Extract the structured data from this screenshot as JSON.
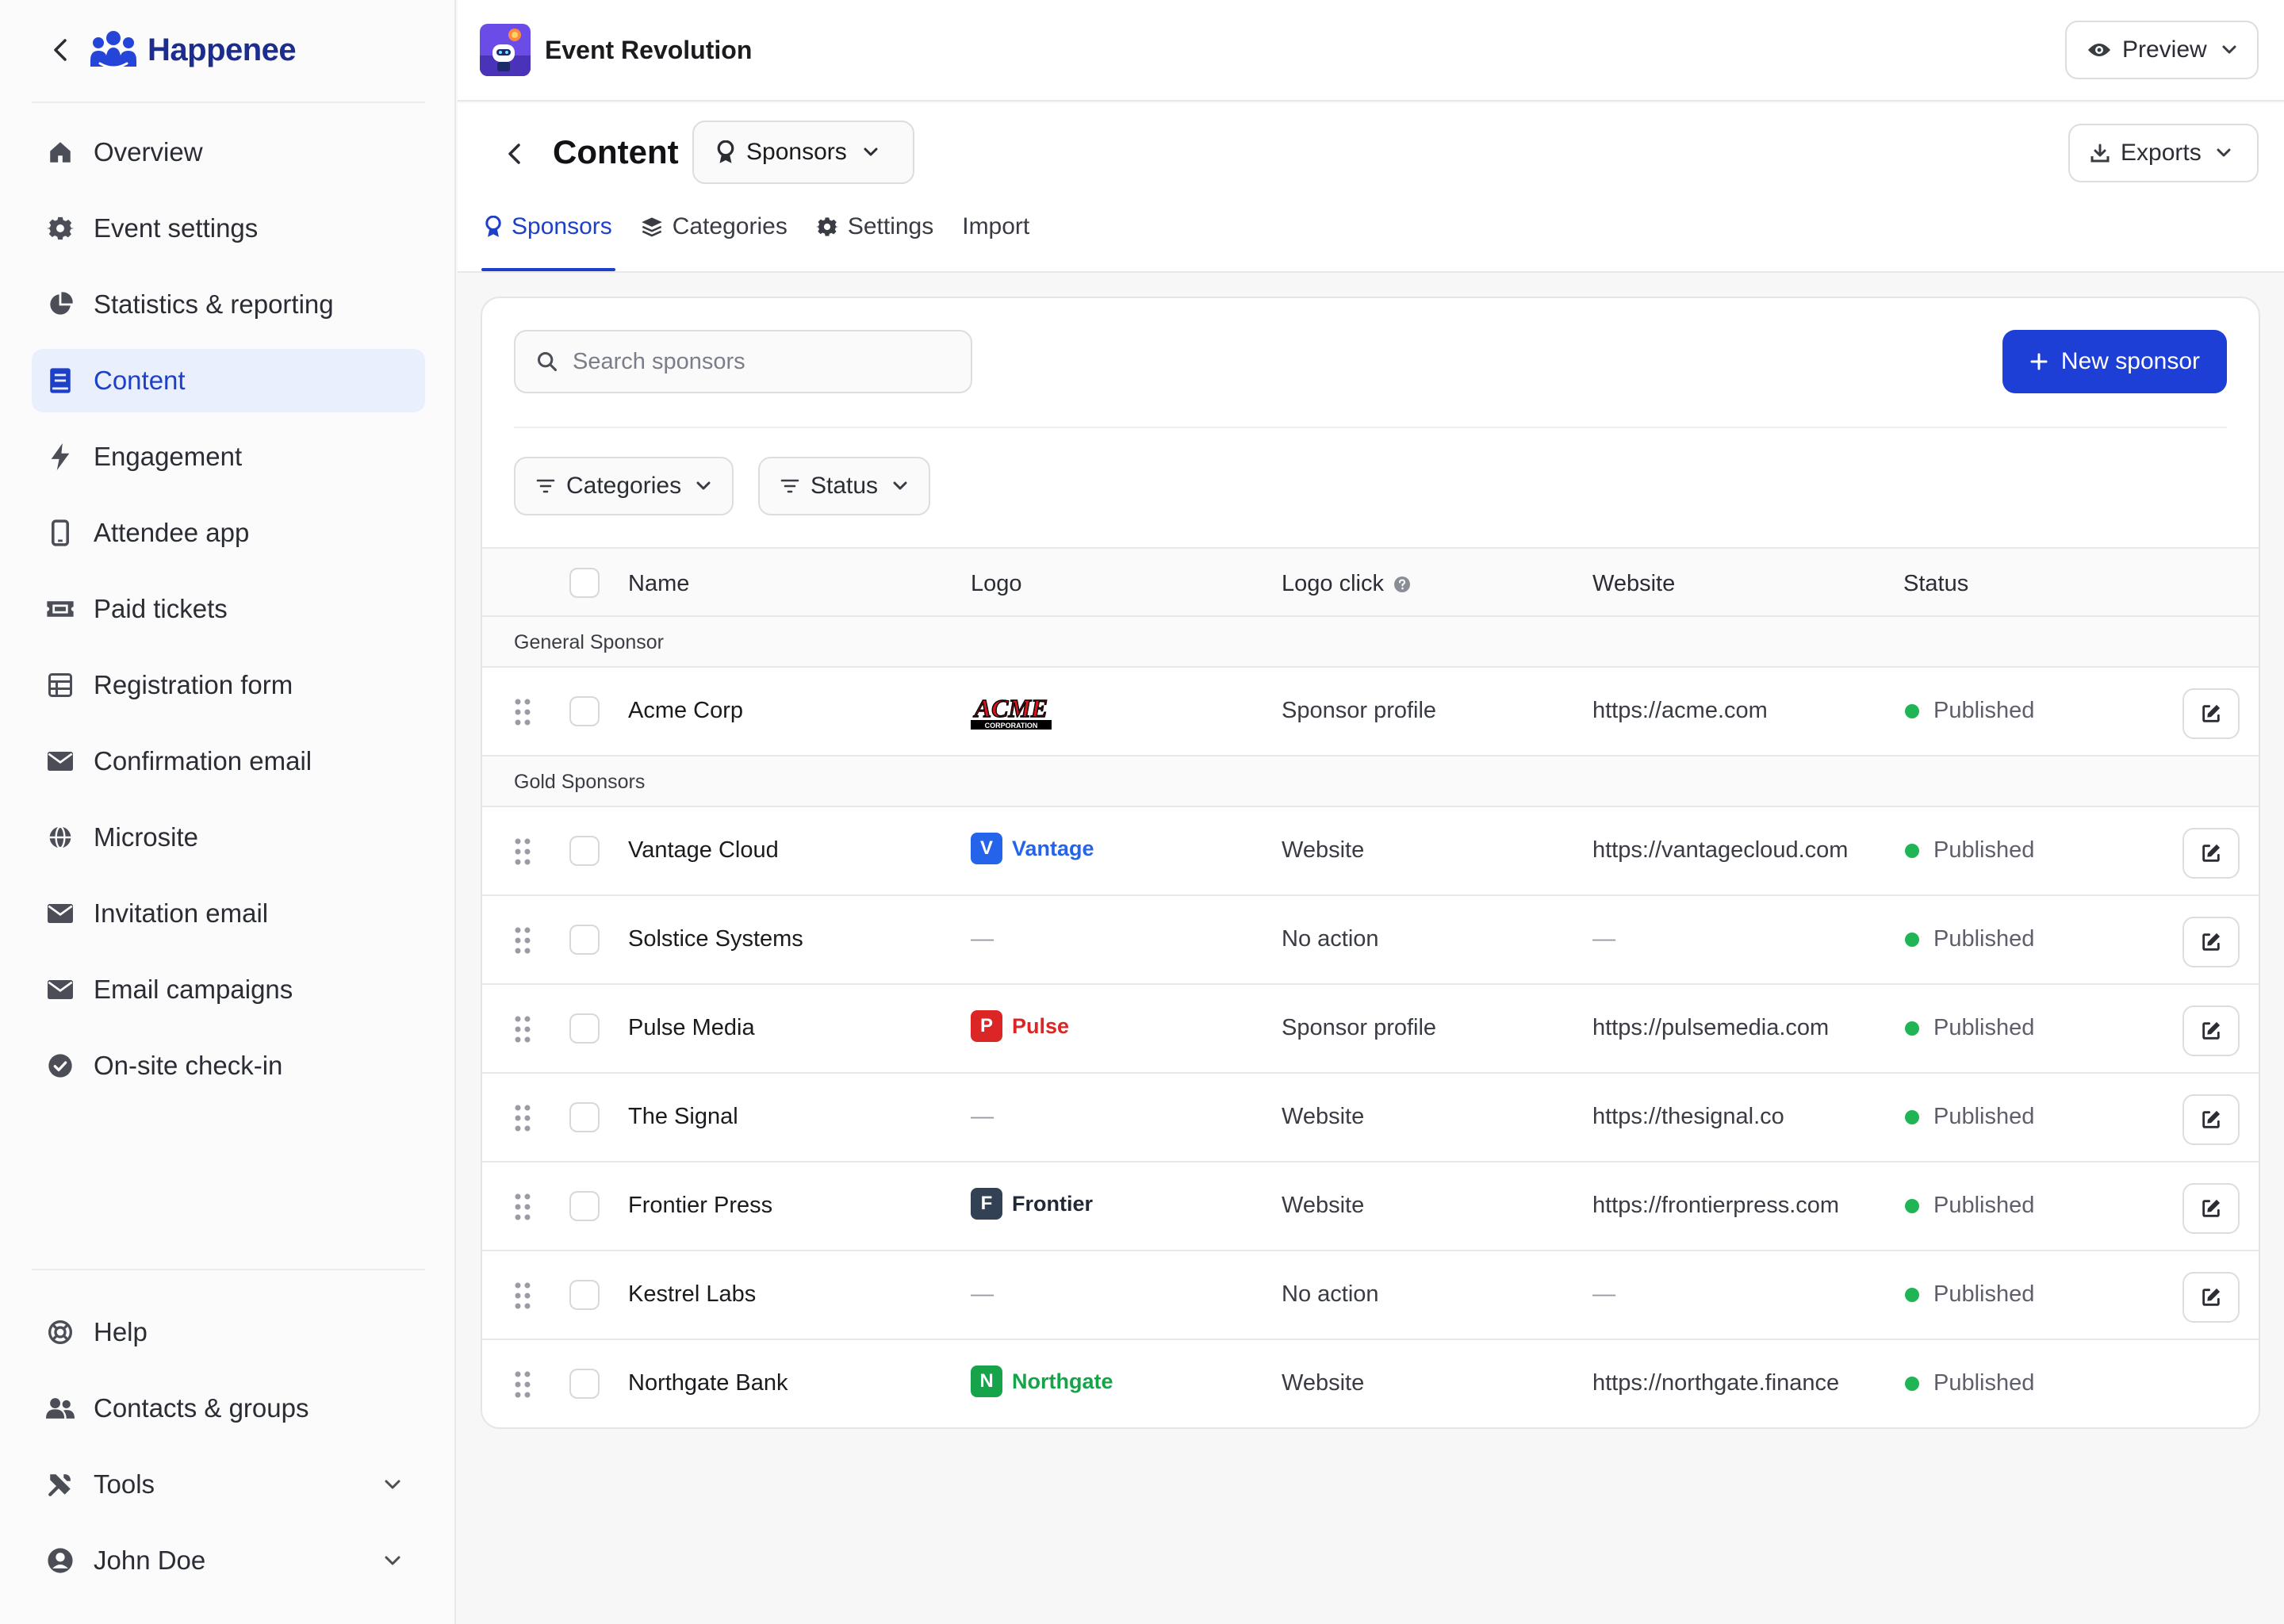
{
  "brand": {
    "name": "Happenee"
  },
  "sidebar": {
    "items": [
      {
        "label": "Overview",
        "icon": "home-icon"
      },
      {
        "label": "Event settings",
        "icon": "gear-icon"
      },
      {
        "label": "Statistics & reporting",
        "icon": "pie-chart-icon"
      },
      {
        "label": "Content",
        "icon": "book-icon",
        "active": true
      },
      {
        "label": "Engagement",
        "icon": "lightning-icon"
      },
      {
        "label": "Attendee app",
        "icon": "mobile-icon"
      },
      {
        "label": "Paid tickets",
        "icon": "ticket-icon"
      },
      {
        "label": "Registration form",
        "icon": "table-icon"
      },
      {
        "label": "Confirmation email",
        "icon": "envelope-icon"
      },
      {
        "label": "Microsite",
        "icon": "globe-icon"
      },
      {
        "label": "Invitation email",
        "icon": "envelope-icon"
      },
      {
        "label": "Email campaigns",
        "icon": "envelope-icon"
      },
      {
        "label": "On-site check-in",
        "icon": "check-circle-icon"
      }
    ],
    "footer": [
      {
        "label": "Help",
        "icon": "lifebuoy-icon"
      },
      {
        "label": "Contacts & groups",
        "icon": "users-icon"
      },
      {
        "label": "Tools",
        "icon": "tools-icon"
      },
      {
        "label": "John Doe",
        "icon": "user-avatar-icon"
      }
    ]
  },
  "topbar": {
    "event_name": "Event Revolution",
    "preview_label": "Preview"
  },
  "content": {
    "title": "Content",
    "section_select": "Sponsors",
    "exports_label": "Exports",
    "tabs": [
      {
        "label": "Sponsors",
        "active": true
      },
      {
        "label": "Categories"
      },
      {
        "label": "Settings"
      },
      {
        "label": "Import"
      }
    ]
  },
  "toolbar": {
    "search_placeholder": "Search sponsors",
    "new_button": "New sponsor",
    "filter_categories": "Categories",
    "filter_status": "Status"
  },
  "table": {
    "columns": [
      "Name",
      "Logo",
      "Logo click",
      "Website",
      "Status"
    ],
    "groups": [
      {
        "name": "General Sponsor",
        "rows": [
          {
            "name": "Acme Corp",
            "logo": "ACME",
            "logo_sub": "CORPORATION",
            "logo_kind": "acme",
            "click": "Sponsor profile",
            "website": "https://acme.com",
            "status": "Published"
          }
        ]
      },
      {
        "name": "Gold Sponsors",
        "rows": [
          {
            "name": "Vantage Cloud",
            "logo": "Vantage",
            "logo_letter": "V",
            "logo_color": "#2563eb",
            "click": "Website",
            "website": "https://vantagecloud.com",
            "status": "Published"
          },
          {
            "name": "Solstice Systems",
            "logo": "—",
            "click": "No action",
            "website": "—",
            "status": "Published"
          },
          {
            "name": "Pulse Media",
            "logo": "Pulse",
            "logo_letter": "P",
            "logo_color": "#dc2626",
            "click": "Sponsor profile",
            "website": "https://pulsemedia.com",
            "status": "Published"
          },
          {
            "name": "The Signal",
            "logo": "—",
            "click": "Website",
            "website": "https://thesignal.co",
            "status": "Published"
          },
          {
            "name": "Frontier Press",
            "logo": "Frontier",
            "logo_letter": "F",
            "logo_color": "#334155",
            "click": "Website",
            "website": "https://frontierpress.com",
            "status": "Published"
          },
          {
            "name": "Kestrel Labs",
            "logo": "—",
            "click": "No action",
            "website": "—",
            "status": "Published"
          },
          {
            "name": "Northgate Bank",
            "logo": "Northgate",
            "logo_letter": "N",
            "logo_color": "#16a34a",
            "click": "Website",
            "website": "https://northgate.finance",
            "status": "Published"
          }
        ]
      }
    ]
  },
  "colors": {
    "accent": "#1d3fd6",
    "published": "#1fb454"
  }
}
